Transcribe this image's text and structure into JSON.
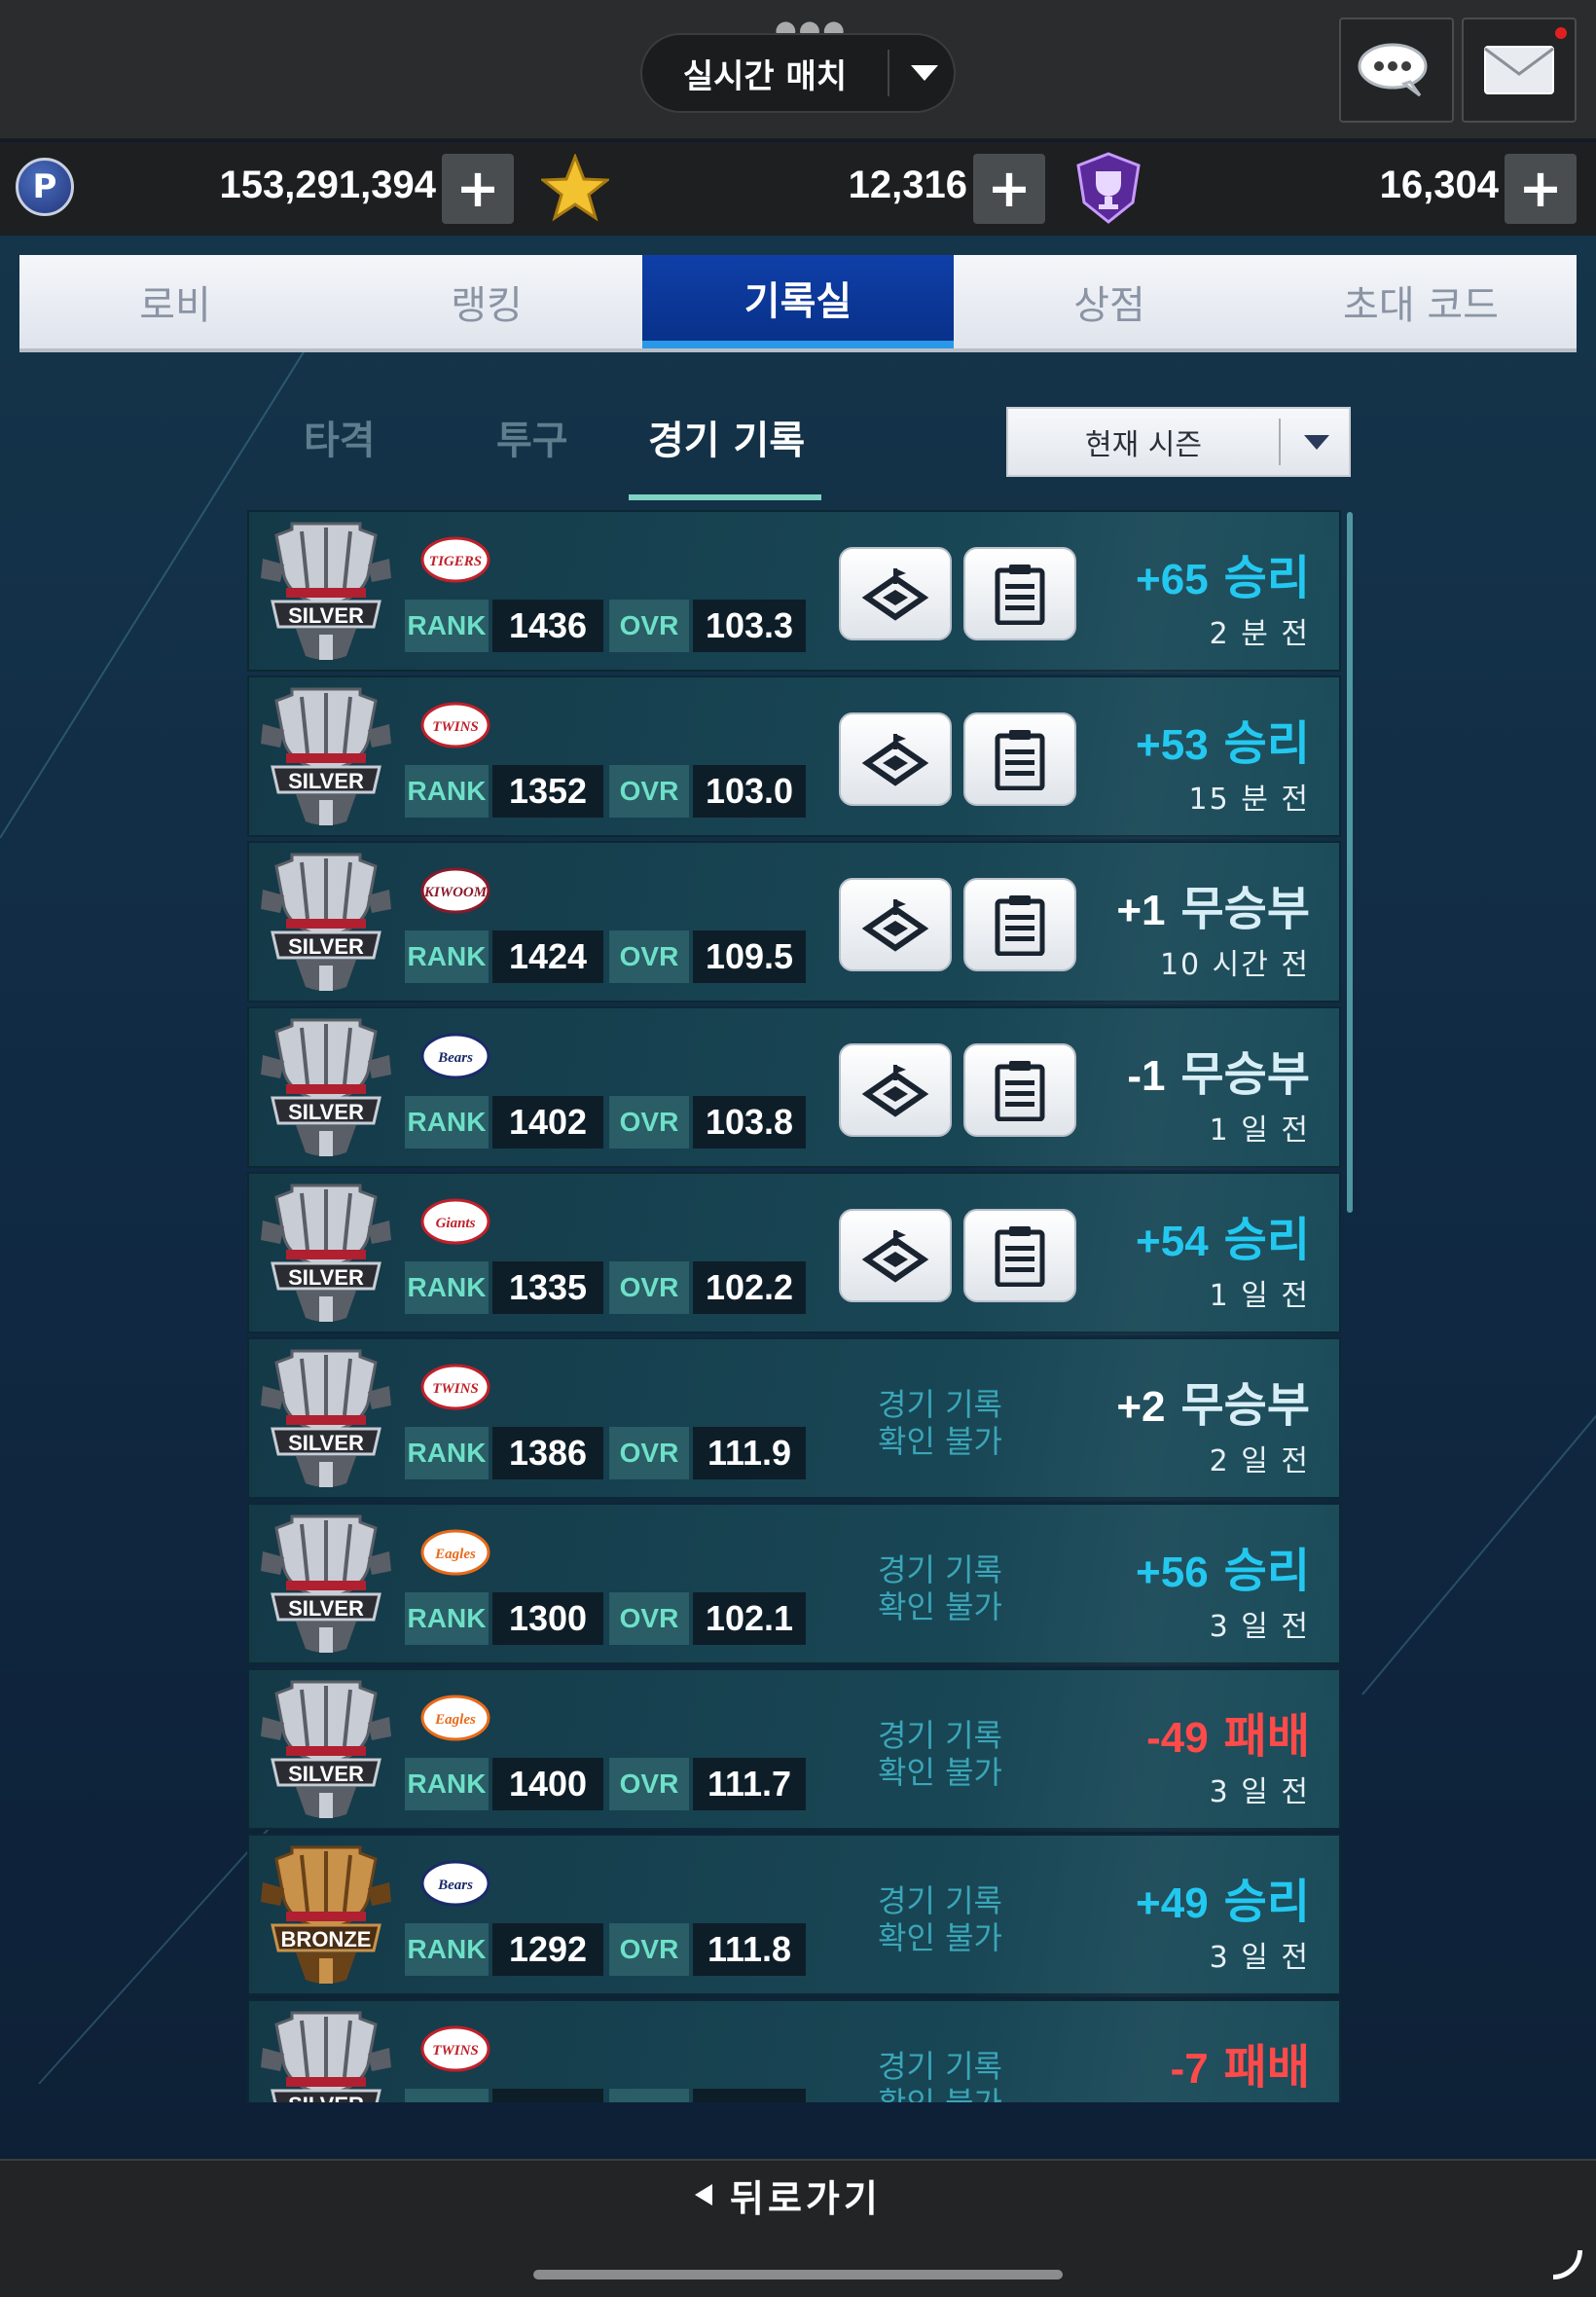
{
  "header": {
    "mode_label": "실시간 매치",
    "chat_icon": "chat-icon",
    "mail_icon": "mail-icon"
  },
  "currency": {
    "points": "153,291,394",
    "stars": "12,316",
    "trophies": "16,304",
    "p_badge": "P"
  },
  "tabs": [
    {
      "label": "로비",
      "active": false
    },
    {
      "label": "랭킹",
      "active": false
    },
    {
      "label": "기록실",
      "active": true
    },
    {
      "label": "상점",
      "active": false
    },
    {
      "label": "초대 코드",
      "active": false
    }
  ],
  "subtabs": [
    {
      "label": "타격",
      "active": false
    },
    {
      "label": "투구",
      "active": false
    },
    {
      "label": "경기 기록",
      "active": true
    }
  ],
  "season_filter": "현재 시즌",
  "labels": {
    "rank": "RANK",
    "ovr": "OVR",
    "no_record": "경기 기록\n확인 불가"
  },
  "records": [
    {
      "league": "SILVER",
      "team": "TIGERS",
      "team_color": "#c0202a",
      "rank": "1436",
      "ovr": "103.3",
      "has_record": true,
      "points": "+65",
      "result": "승리",
      "type": "win",
      "ago": "2 분 전"
    },
    {
      "league": "SILVER",
      "team": "TWINS",
      "team_color": "#c0202a",
      "rank": "1352",
      "ovr": "103.0",
      "has_record": true,
      "points": "+53",
      "result": "승리",
      "type": "win",
      "ago": "15 분 전"
    },
    {
      "league": "SILVER",
      "team": "KIWOOM",
      "team_color": "#8a1a2a",
      "rank": "1424",
      "ovr": "109.5",
      "has_record": true,
      "points": "+1",
      "result": "무승부",
      "type": "draw",
      "ago": "10 시간 전"
    },
    {
      "league": "SILVER",
      "team": "Bears",
      "team_color": "#1a2a6a",
      "rank": "1402",
      "ovr": "103.8",
      "has_record": true,
      "points": "-1",
      "result": "무승부",
      "type": "draw",
      "ago": "1 일 전"
    },
    {
      "league": "SILVER",
      "team": "Giants",
      "team_color": "#c0202a",
      "rank": "1335",
      "ovr": "102.2",
      "has_record": true,
      "points": "+54",
      "result": "승리",
      "type": "win",
      "ago": "1 일 전"
    },
    {
      "league": "SILVER",
      "team": "TWINS",
      "team_color": "#c0202a",
      "rank": "1386",
      "ovr": "111.9",
      "has_record": false,
      "points": "+2",
      "result": "무승부",
      "type": "draw",
      "ago": "2 일 전"
    },
    {
      "league": "SILVER",
      "team": "Eagles",
      "team_color": "#e86a1a",
      "rank": "1300",
      "ovr": "102.1",
      "has_record": false,
      "points": "+56",
      "result": "승리",
      "type": "win",
      "ago": "3 일 전"
    },
    {
      "league": "SILVER",
      "team": "Eagles",
      "team_color": "#e86a1a",
      "rank": "1400",
      "ovr": "111.7",
      "has_record": false,
      "points": "-49",
      "result": "패배",
      "type": "lose",
      "ago": "3 일 전"
    },
    {
      "league": "BRONZE",
      "team": "Bears",
      "team_color": "#1a2a6a",
      "rank": "1292",
      "ovr": "111.8",
      "has_record": false,
      "points": "+49",
      "result": "승리",
      "type": "win",
      "ago": "3 일 전"
    },
    {
      "league": "SILVER",
      "team": "TWINS",
      "team_color": "#c0202a",
      "rank": "",
      "ovr": "",
      "has_record": false,
      "points": "-7",
      "result": "패배",
      "type": "lose",
      "ago": ""
    }
  ],
  "back_label": "뒤로가기",
  "colors": {
    "win": "#23c8f0",
    "lose": "#ff4a4a",
    "draw": "#ffffff",
    "active_tab": "#0f3fa8",
    "tab_underline": "#2a98e8"
  }
}
